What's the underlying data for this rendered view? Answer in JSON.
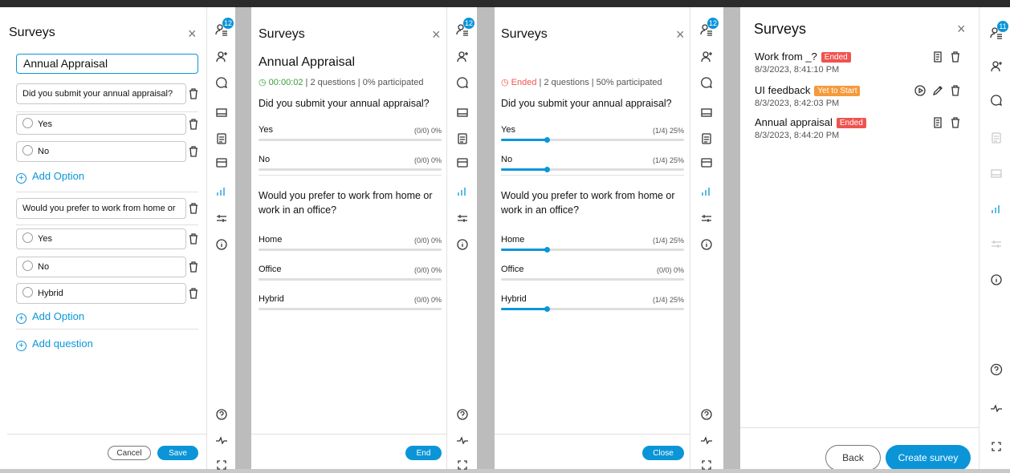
{
  "colors": {
    "accent": "#0b95d8",
    "ended": "#ef5350",
    "yet_to_start": "#f59a3b",
    "timer": "#3a9b3a"
  },
  "panel1": {
    "title": "Surveys",
    "close_icon": "close-icon",
    "survey_title_value": "Annual Appraisal",
    "q1": "Did you submit your annual appraisal?",
    "q1_options": [
      "Yes",
      "No"
    ],
    "add_option": "Add Option",
    "q2": "Would you prefer to work from home or",
    "q2_options": [
      "Yes",
      "No",
      "Hybrid"
    ],
    "add_question": "Add question",
    "cancel": "Cancel",
    "save": "Save"
  },
  "rail1": {
    "badge": "12"
  },
  "panel2": {
    "title": "Surveys",
    "survey_name": "Annual Appraisal",
    "timer": "00:00:02",
    "stats": "2 questions | 0% participated",
    "q1": "Did you submit your annual appraisal?",
    "q1_opts": [
      {
        "label": "Yes",
        "pct": "(0/0) 0%",
        "value": 0
      },
      {
        "label": "No",
        "pct": "(0/0) 0%",
        "value": 0
      }
    ],
    "q2_line1": "Would you prefer to work from home or",
    "q2_line2": "work in an office?",
    "q2_opts": [
      {
        "label": "Home",
        "pct": "(0/0) 0%",
        "value": 0
      },
      {
        "label": "Office",
        "pct": "(0/0) 0%",
        "value": 0
      },
      {
        "label": "Hybrid",
        "pct": "(0/0) 0%",
        "value": 0
      }
    ],
    "end": "End"
  },
  "rail2": {
    "badge": "12"
  },
  "panel3": {
    "title": "Surveys",
    "status": "Ended",
    "stats": "2 questions | 50% participated",
    "q1": "Did you submit your annual appraisal?",
    "q1_opts": [
      {
        "label": "Yes",
        "pct": "(1/4) 25%",
        "value": 0.25
      },
      {
        "label": "No",
        "pct": "(1/4) 25%",
        "value": 0.25
      }
    ],
    "q2_line1": "Would you prefer to work from home or",
    "q2_line2": "work in an office?",
    "q2_opts": [
      {
        "label": "Home",
        "pct": "(1/4) 25%",
        "value": 0.25
      },
      {
        "label": "Office",
        "pct": "(0/0) 0%",
        "value": 0
      },
      {
        "label": "Hybrid",
        "pct": "(1/4) 25%",
        "value": 0.25
      }
    ],
    "close": "Close"
  },
  "rail3": {
    "badge": "12"
  },
  "panel4": {
    "title": "Surveys",
    "surveys": [
      {
        "name": "Work from _?",
        "status": "Ended",
        "date": "8/3/2023, 8:41:10 PM"
      },
      {
        "name": "UI feedback",
        "status": "Yet to Start",
        "date": "8/3/2023, 8:42:03 PM"
      },
      {
        "name": "Annual appraisal",
        "status": "Ended",
        "date": "8/3/2023, 8:44:20 PM"
      }
    ],
    "back": "Back",
    "create": "Create survey"
  },
  "rail4": {
    "badge": "11"
  }
}
